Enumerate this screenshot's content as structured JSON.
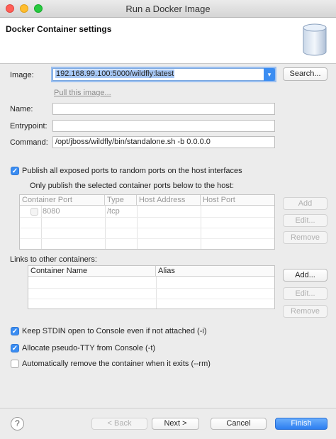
{
  "window": {
    "title": "Run a Docker Image"
  },
  "header": {
    "title": "Docker Container settings",
    "icon": "docker-database-icon"
  },
  "image": {
    "label": "Image:",
    "value": "192.168.99.100:5000/wildfly:latest",
    "search_button": "Search...",
    "pull_link": "Pull this image..."
  },
  "name": {
    "label": "Name:",
    "value": ""
  },
  "entrypoint": {
    "label": "Entrypoint:",
    "value": ""
  },
  "command": {
    "label": "Command:",
    "value": "/opt/jboss/wildfly/bin/standalone.sh -b 0.0.0.0"
  },
  "publish_all": {
    "label": "Publish all exposed ports to random ports on the host interfaces",
    "checked": true
  },
  "ports": {
    "subtitle": "Only publish the selected container ports below to the host:",
    "columns": [
      "Container Port",
      "Type",
      "Host Address",
      "Host Port"
    ],
    "rows": [
      {
        "container_port": "8080",
        "type": "/tcp",
        "host_address": "",
        "host_port": ""
      }
    ],
    "buttons": {
      "add": "Add",
      "edit": "Edit...",
      "remove": "Remove"
    }
  },
  "links": {
    "title": "Links to other containers:",
    "columns": [
      "Container Name",
      "Alias"
    ],
    "buttons": {
      "add": "Add...",
      "edit": "Edit...",
      "remove": "Remove"
    }
  },
  "options": {
    "keep_stdin": {
      "label": "Keep STDIN open to Console even if not attached (-i)",
      "checked": true
    },
    "pseudo_tty": {
      "label": "Allocate pseudo-TTY from Console (-t)",
      "checked": true
    },
    "auto_remove": {
      "label": "Automatically remove the container when it exits (--rm)",
      "checked": false
    }
  },
  "footer": {
    "help_icon": "help-icon",
    "back": "< Back",
    "next": "Next >",
    "cancel": "Cancel",
    "finish": "Finish"
  },
  "colors": {
    "accent": "#3b8df2",
    "finish_button": "#2d7ef0",
    "selection": "#a8c8f5"
  }
}
